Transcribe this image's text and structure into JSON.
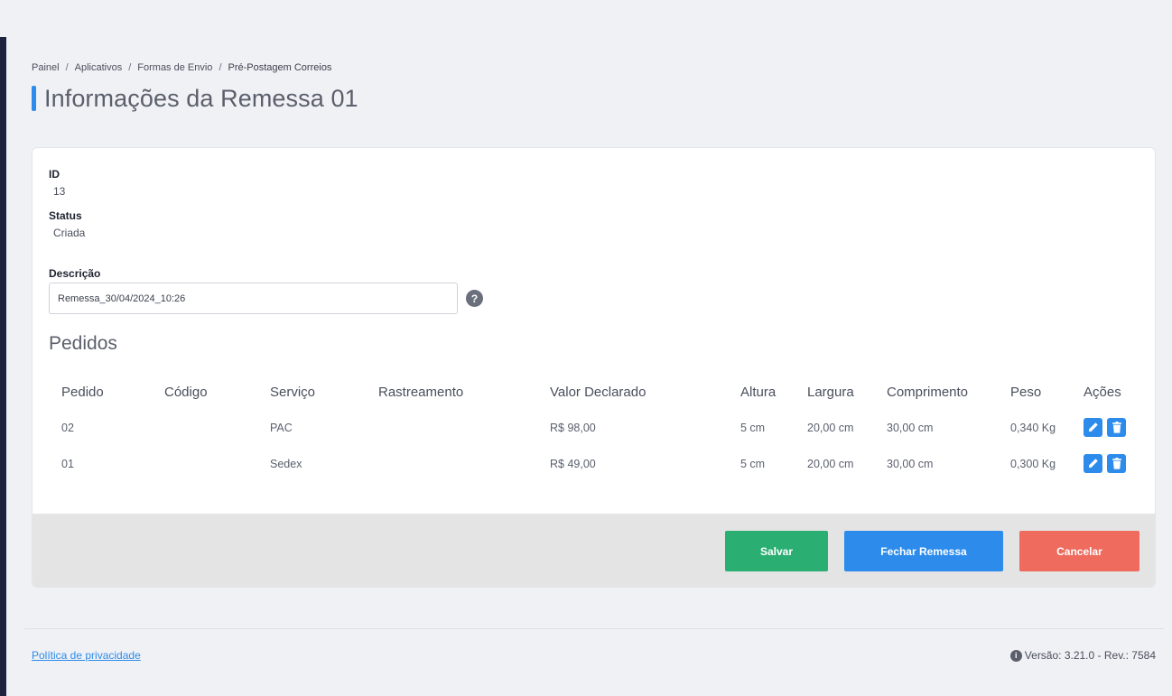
{
  "breadcrumb": {
    "items": [
      "Painel",
      "Aplicativos",
      "Formas de Envio",
      "Pré-Postagem Correios"
    ],
    "separator": "/"
  },
  "page": {
    "title": "Informações da Remessa 01"
  },
  "shipment": {
    "id_label": "ID",
    "id_value": "13",
    "status_label": "Status",
    "status_value": "Criada",
    "description_label": "Descrição",
    "description_value": "Remessa_30/04/2024_10:26",
    "help_icon": "question-circle-icon"
  },
  "orders": {
    "title": "Pedidos",
    "columns": [
      "Pedido",
      "Código",
      "Serviço",
      "Rastreamento",
      "Valor Declarado",
      "Altura",
      "Largura",
      "Comprimento",
      "Peso",
      "Ações"
    ],
    "rows": [
      {
        "pedido": "02",
        "codigo": "",
        "servico": "PAC",
        "rastreamento": "",
        "valor": "R$ 98,00",
        "altura": "5 cm",
        "largura": "20,00 cm",
        "comprimento": "30,00 cm",
        "peso": "0,340 Kg"
      },
      {
        "pedido": "01",
        "codigo": "",
        "servico": "Sedex",
        "rastreamento": "",
        "valor": "R$ 49,00",
        "altura": "5 cm",
        "largura": "20,00 cm",
        "comprimento": "30,00 cm",
        "peso": "0,300 Kg"
      }
    ],
    "action_icons": [
      "pencil-icon",
      "trash-icon"
    ]
  },
  "actions": {
    "save": "Salvar",
    "close_shipment": "Fechar Remessa",
    "cancel": "Cancelar"
  },
  "footer": {
    "privacy": "Política de privacidade",
    "version": "Versão: 3.21.0 - Rev.: 7584"
  },
  "colors": {
    "accent": "#2d8ceb",
    "save": "#2aae72",
    "cancel": "#ee6b5e",
    "sidebar": "#1f2340",
    "background": "#f0f1f5"
  }
}
